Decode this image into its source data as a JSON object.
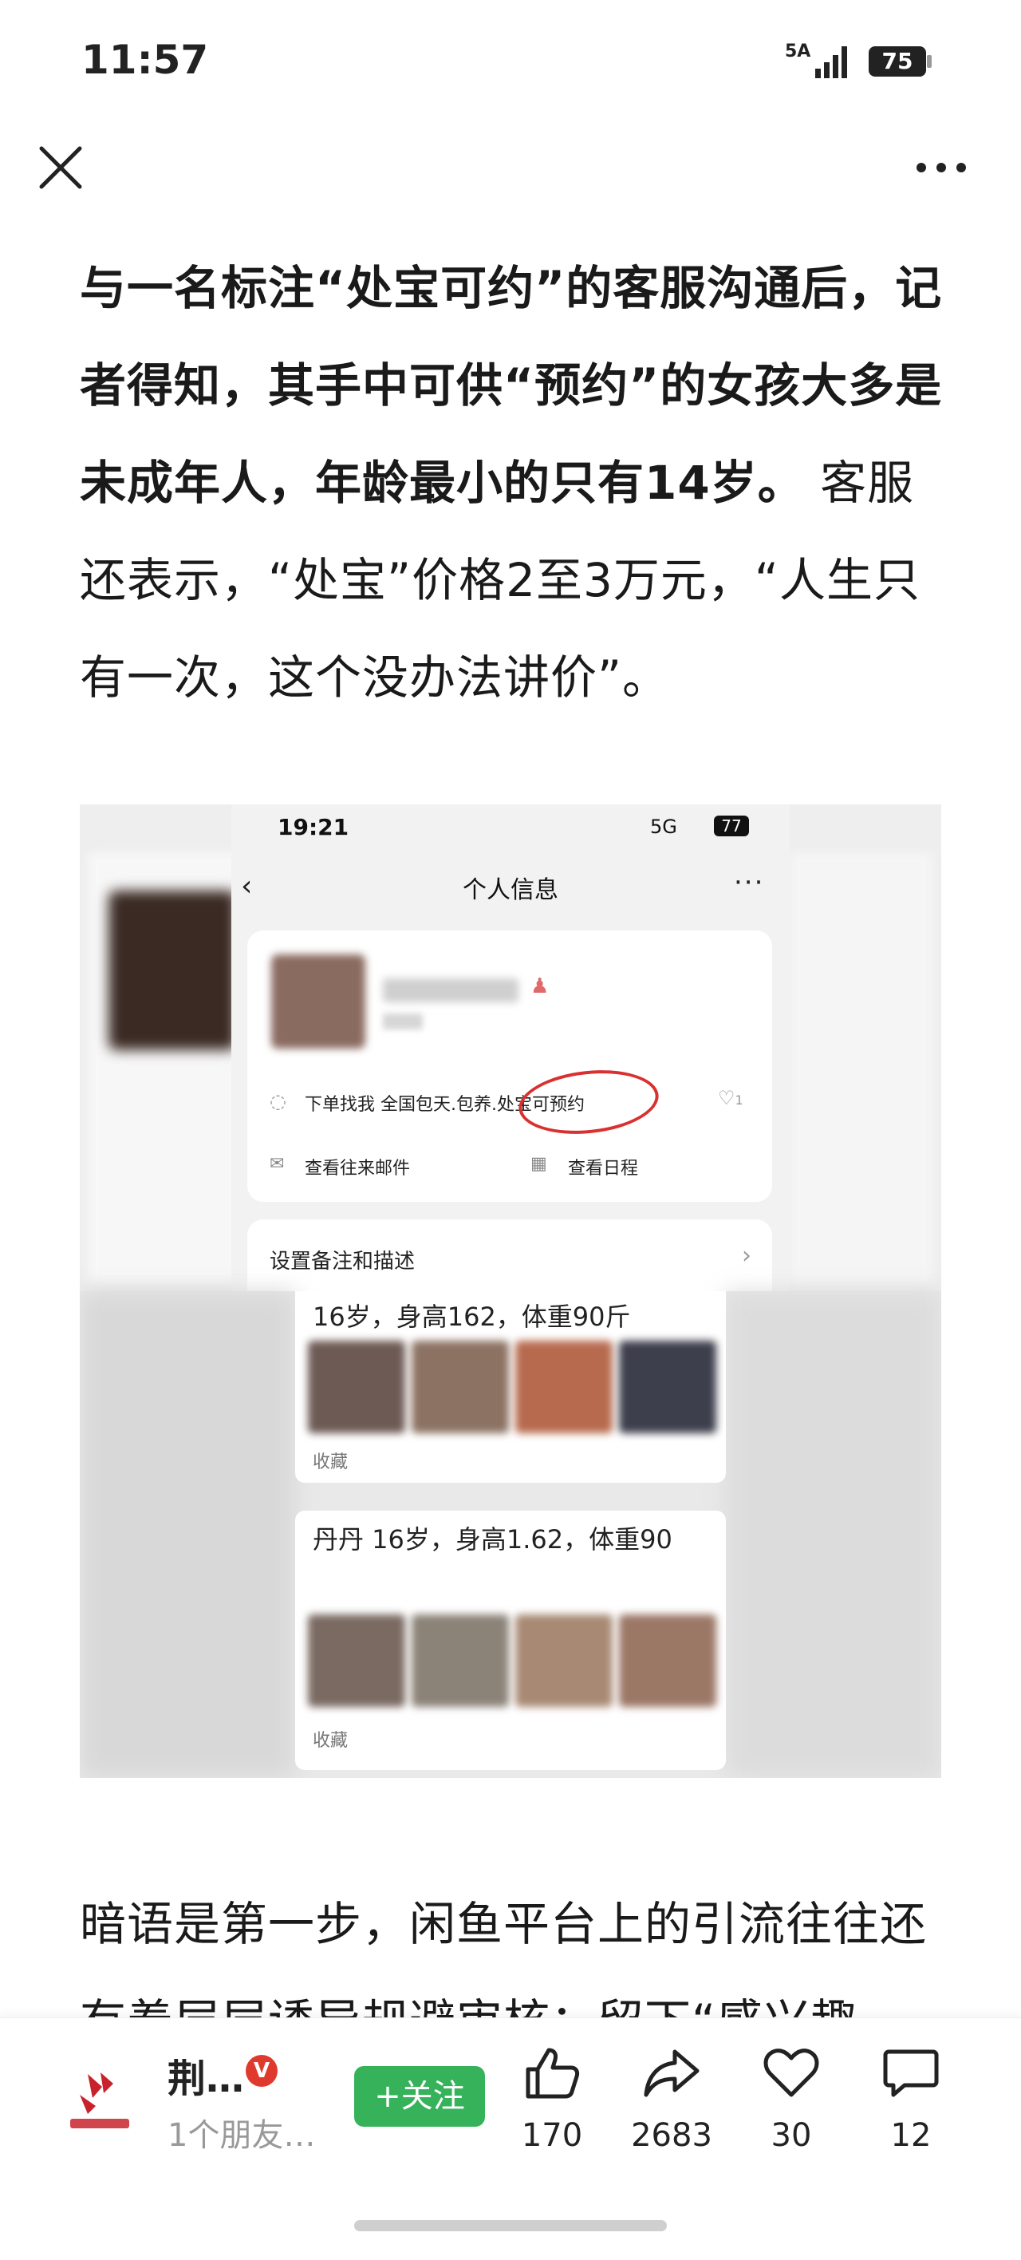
{
  "status_bar": {
    "time": "11:57",
    "network": "5A",
    "battery": "75"
  },
  "article": {
    "para1_bold": "与一名标注“处宝可约”的客服沟通后，记者得知，其手中可供“预约”的女孩大多是未成年人，年龄最小的只有14岁。",
    "para1_rest": " 客服还表示，“处宝”价格2至3万元，“人生只有一次，这个没办法讲价”。",
    "para2": "暗语是第一步，闲鱼平台上的引流往往还有着层层诱导规避审核：留下“感兴趣"
  },
  "screenshot": {
    "time": "19:21",
    "network": "5G",
    "battery": "77",
    "title": "个人信息",
    "signature": "下单找我  全国包天.包养.处宝可预约",
    "like_count": "1",
    "mail": "查看往来邮件",
    "calendar": "查看日程",
    "remark": "设置备注和描述",
    "post1": "16岁，身高162，体重90斤",
    "post1_fav": "收藏",
    "post2": "丹丹 16岁，身高1.62，体重90",
    "post2_fav": "收藏"
  },
  "bottom_bar": {
    "source_name": "荆…",
    "verified_badge": "V",
    "source_sub": "1个朋友…",
    "follow_label": "+关注",
    "likes": "170",
    "shares": "2683",
    "favorites": "30",
    "comments": "12"
  }
}
